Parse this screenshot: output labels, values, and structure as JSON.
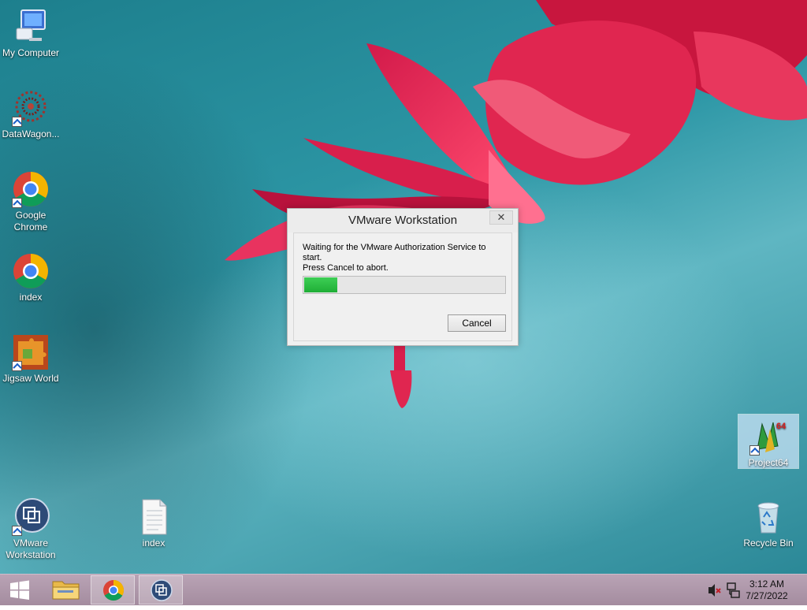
{
  "desktop": {
    "icons": [
      {
        "label": "My Computer"
      },
      {
        "label": "DataWagon..."
      },
      {
        "label": "Google Chrome"
      },
      {
        "label": "index"
      },
      {
        "label": "Jigsaw World"
      },
      {
        "label": "VMware Workstation"
      },
      {
        "label": "index"
      },
      {
        "label": "Project64"
      },
      {
        "label": "Recycle Bin"
      }
    ]
  },
  "dialog": {
    "title": "VMware Workstation",
    "close_glyph": "✕",
    "message_line1": "Waiting for the VMware Authorization Service to start.",
    "message_line2": "Press Cancel to abort.",
    "progress_fraction": 0.17,
    "cancel_label": "Cancel"
  },
  "taskbar": {
    "buttons": [
      {
        "name": "start-button",
        "icon": "windows-logo-icon"
      },
      {
        "name": "file-explorer",
        "icon": "folder-icon"
      },
      {
        "name": "chrome",
        "icon": "chrome-icon",
        "active": true
      },
      {
        "name": "vmware-workstation",
        "icon": "vmware-icon",
        "active": true
      }
    ],
    "tray": {
      "volume_icon": "speaker-muted-icon",
      "network_icon": "network-icon",
      "time": "3:12 AM",
      "date": "7/27/2022"
    }
  },
  "colors": {
    "progress_green": "#1fae36",
    "taskbar": "#a48c9f",
    "desktop_teal": "#2d97a6"
  }
}
